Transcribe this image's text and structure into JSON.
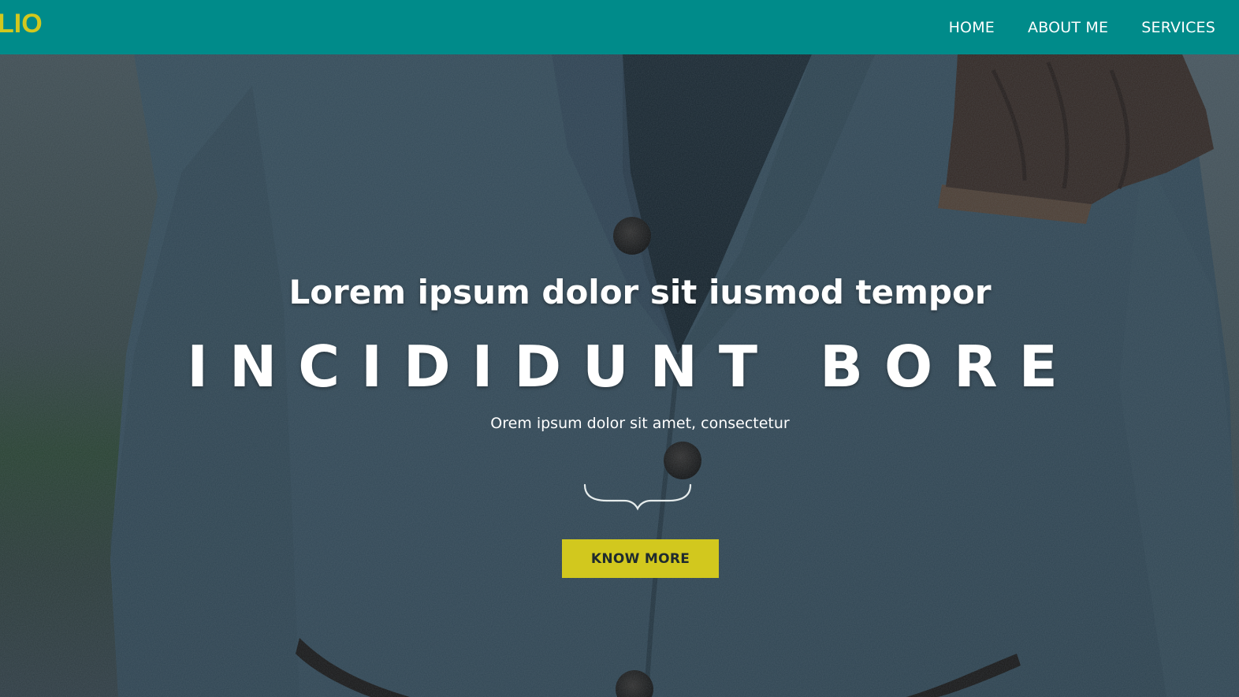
{
  "navbar": {
    "brand": "LIO",
    "links": [
      {
        "label": "HOME"
      },
      {
        "label": "ABOUT ME"
      },
      {
        "label": "SERVICES"
      }
    ],
    "background": "#008b8a",
    "brand_color": "#d2c81e"
  },
  "hero": {
    "subtitle": "Lorem ipsum dolor sit iusmod tempor",
    "title": "INCIDIDUNT BORE",
    "tagline": "Orem ipsum dolor sit amet, consectetur",
    "divider_icon": "curly-brace-divider-icon",
    "cta_label": "KNOW MORE",
    "cta_color": "#d2c81e"
  }
}
